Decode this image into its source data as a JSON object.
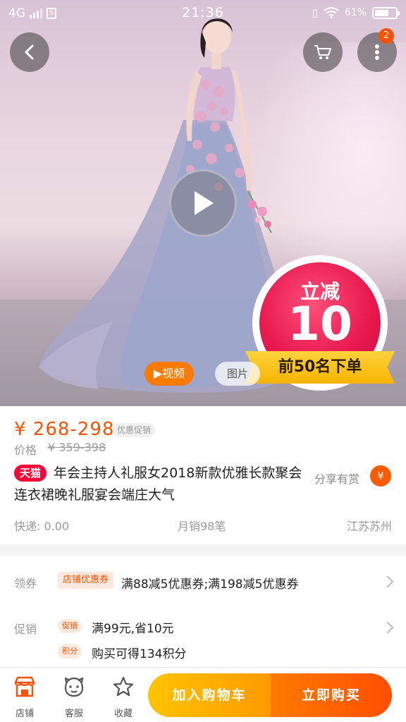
{
  "status_bar": {
    "network": "4G",
    "time": "21:36",
    "battery": "61%"
  },
  "header": {
    "cart_badge": "2"
  },
  "media": {
    "video_label": "▶视频",
    "pictures_label": "图片"
  },
  "promo_sticker": {
    "line1": "立减",
    "amount": "10",
    "ribbon": "前50名下单"
  },
  "product": {
    "price": "¥ 268-298",
    "price_tag": "优惠促销",
    "original_label": "价格",
    "original_price": "¥ 359-398",
    "store_badge": "天猫",
    "title": "年会主持人礼服女2018新款优雅长款聚会连衣裙晚礼服宴会端庄大气",
    "share_label": "分享有赏",
    "share_icon": "¥",
    "shipping": "快递: 0.00",
    "monthly_sales": "月销98笔",
    "location": "江苏苏州"
  },
  "coupons": {
    "label": "领券",
    "tag": "店铺优惠券",
    "text": "满88减5优惠券;满198减5优惠券"
  },
  "promotion": {
    "label": "促销",
    "tag1": "促销",
    "text1": "满99元,省10元",
    "tag2": "积分",
    "text2": "购买可得134积分"
  },
  "bottom_bar": {
    "tabs": [
      {
        "label": "店铺",
        "icon": "store-icon"
      },
      {
        "label": "客服",
        "icon": "customer-service-icon"
      },
      {
        "label": "收藏",
        "icon": "star-icon"
      }
    ],
    "add_to_cart": "加入购物车",
    "buy_now": "立即购买"
  },
  "colors": {
    "accent": "#ff5000",
    "tmall_red": "#ff0036",
    "cart_yellow": "#ffc400",
    "buy_orange": "#ff5000"
  }
}
